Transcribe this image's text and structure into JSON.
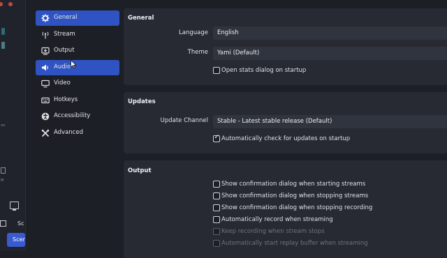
{
  "background": {
    "side_label_1": "vo",
    "side_label_2": "M",
    "scene_header": "Sc",
    "scene_button": "Scen"
  },
  "sidebar": {
    "items": [
      {
        "label": "General",
        "icon": "gear-icon",
        "active": true
      },
      {
        "label": "Stream",
        "icon": "antenna-icon",
        "active": false
      },
      {
        "label": "Output",
        "icon": "output-icon",
        "active": false
      },
      {
        "label": "Audio",
        "icon": "speaker-icon",
        "active": true
      },
      {
        "label": "Video",
        "icon": "monitor-icon",
        "active": false
      },
      {
        "label": "Hotkeys",
        "icon": "keyboard-icon",
        "active": false
      },
      {
        "label": "Accessibility",
        "icon": "accessibility-icon",
        "active": false
      },
      {
        "label": "Advanced",
        "icon": "wrench-icon",
        "active": false
      }
    ]
  },
  "general": {
    "title": "General",
    "language_label": "Language",
    "language_value": "English",
    "theme_label": "Theme",
    "theme_value": "Yami (Default)",
    "open_stats_label": "Open stats dialog on startup",
    "open_stats_checked": false
  },
  "updates": {
    "title": "Updates",
    "channel_label": "Update Channel",
    "channel_value": "Stable - Latest stable release (Default)",
    "auto_check_label": "Automatically check for updates on startup",
    "auto_check_checked": true
  },
  "output": {
    "title": "Output",
    "options": [
      {
        "label": "Show confirmation dialog when starting streams",
        "checked": false,
        "enabled": true
      },
      {
        "label": "Show confirmation dialog when stopping streams",
        "checked": false,
        "enabled": true
      },
      {
        "label": "Show confirmation dialog when stopping recording",
        "checked": false,
        "enabled": true
      },
      {
        "label": "Automatically record when streaming",
        "checked": false,
        "enabled": true
      },
      {
        "label": "Keep recording when stream stops",
        "checked": false,
        "enabled": false
      },
      {
        "label": "Automatically start replay buffer when streaming",
        "checked": false,
        "enabled": false
      }
    ]
  },
  "colors": {
    "accent": "#2f53c2",
    "panel": "#272a33",
    "window_bg": "#1d1f26"
  }
}
